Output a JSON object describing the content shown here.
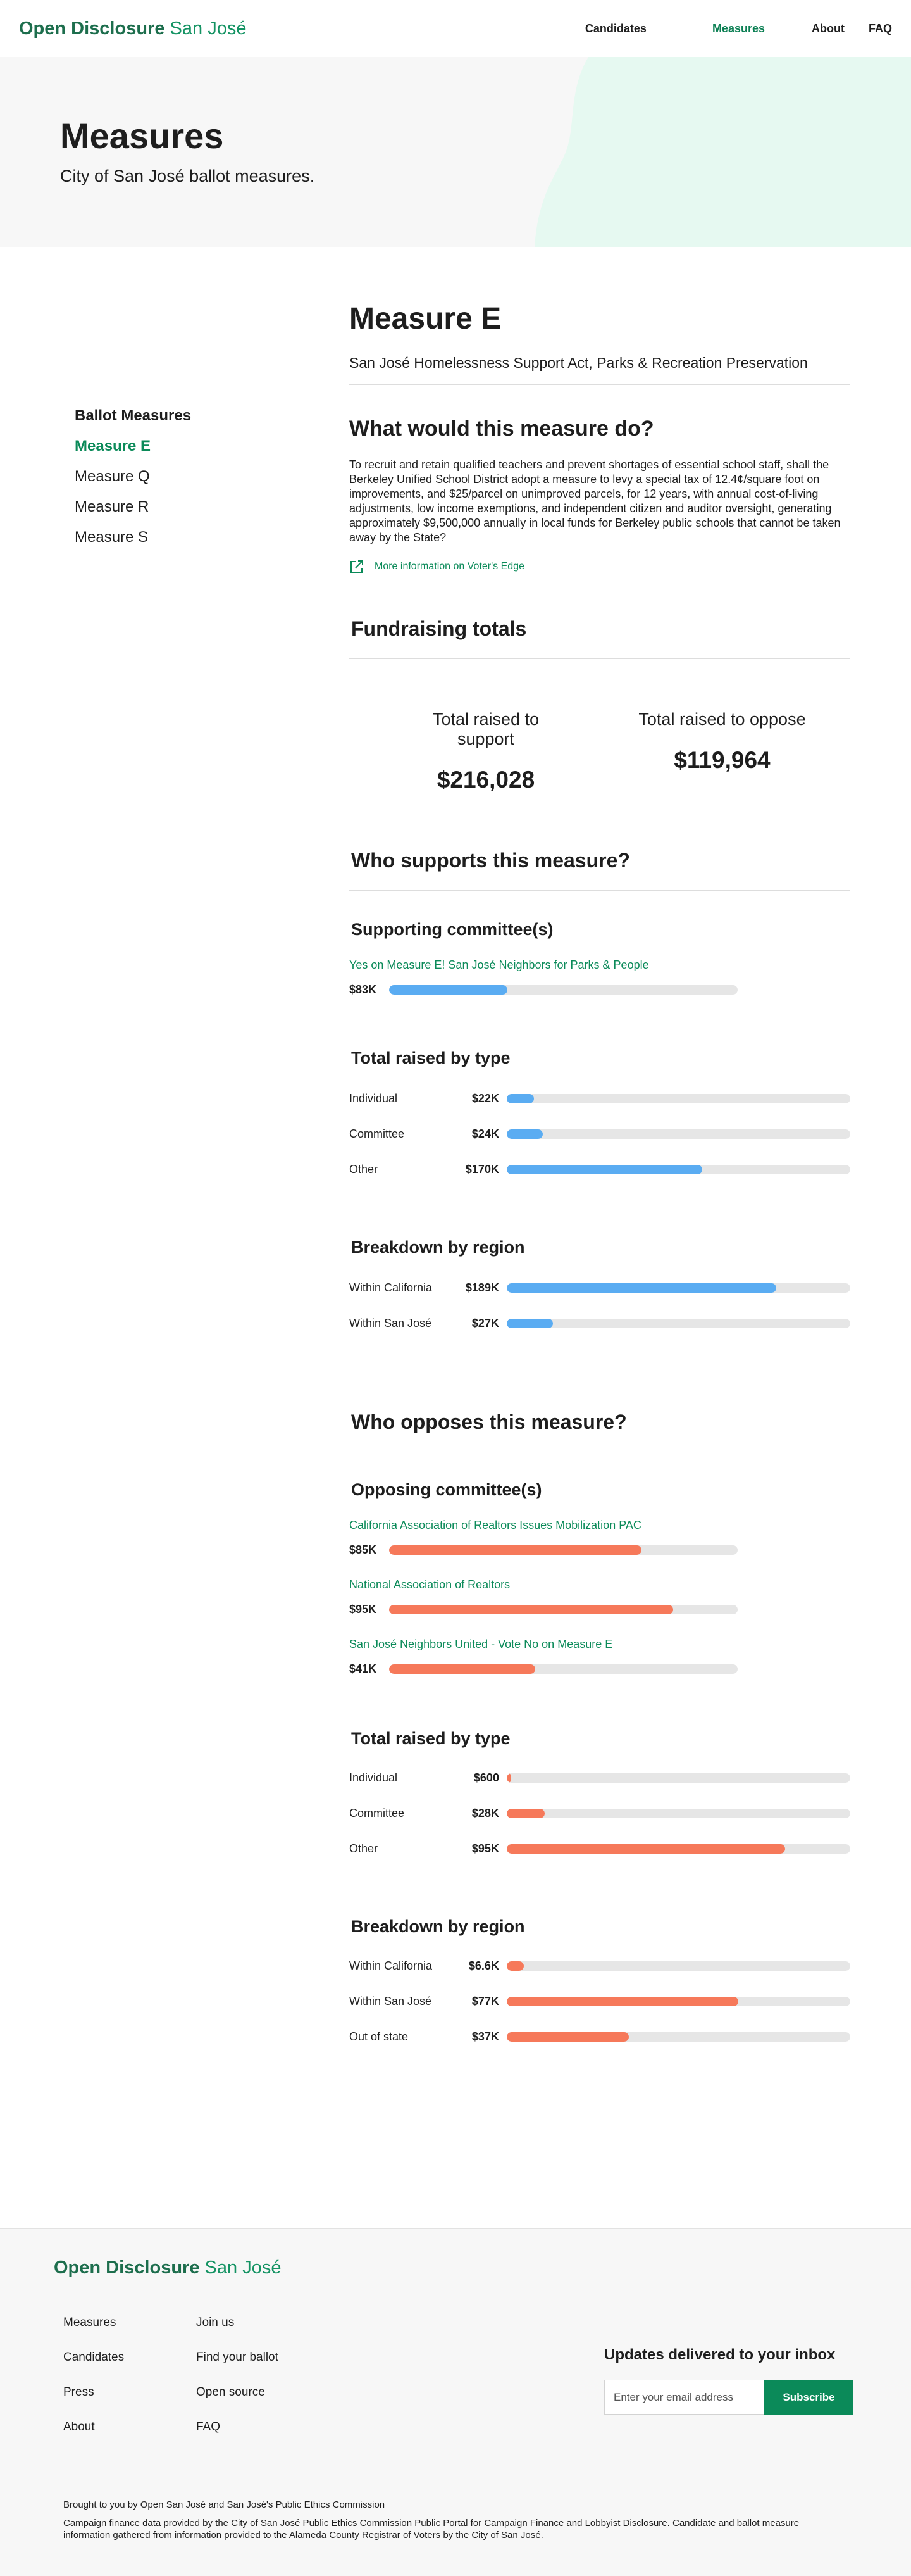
{
  "header": {
    "logo_main": "Open Disclosure",
    "logo_city": "San José",
    "nav": {
      "candidates": "Candidates",
      "measures": "Measures",
      "about": "About",
      "faq": "FAQ"
    }
  },
  "hero": {
    "title": "Measures",
    "subtitle": "City of San José  ballot measures."
  },
  "sidebar": {
    "heading": "Ballot Measures",
    "items": [
      "Measure E",
      "Measure Q",
      "Measure R",
      "Measure S"
    ]
  },
  "measure": {
    "title": "Measure E",
    "subtitle": "San José Homelessness Support  Act, Parks & Recreation Preservation",
    "question": "What would this measure do?",
    "description": "To recruit and retain qualified teachers and prevent shortages of essential school staff, shall the Berkeley Unified School District adopt a measure to levy a special tax of 12.4¢/square foot on improvements, and $25/parcel on unimproved parcels, for 12 years, with annual cost-of-living adjustments, low income exemptions, and independent citizen and auditor oversight, generating approximately $9,500,000 annually in local funds for Berkeley public schools that cannot be taken away by the State?",
    "link": "More information on Voter's Edge"
  },
  "fundraising": {
    "heading": "Fundraising totals",
    "support_label": "Total raised to support",
    "support_value": "$216,028",
    "oppose_label": "Total raised to oppose",
    "oppose_value": "$119,964"
  },
  "supporters": {
    "heading": "Who supports this measure?",
    "committees_heading": "Supporting committee(s)",
    "committees": [
      {
        "name": "Yes on Measure E! San José Neighbors for Parks & People",
        "amount": "$83K",
        "fraction": 0.34
      }
    ],
    "type_heading": "Total raised by type",
    "types": [
      {
        "label": "Individual",
        "amount": "$22K",
        "fraction": 0.08
      },
      {
        "label": "Committee",
        "amount": "$24K",
        "fraction": 0.105
      },
      {
        "label": "Other",
        "amount": "$170K",
        "fraction": 0.57
      }
    ],
    "region_heading": "Breakdown by region",
    "regions": [
      {
        "label": "Within California",
        "amount": "$189K",
        "fraction": 0.785
      },
      {
        "label": "Within San José",
        "amount": "$27K",
        "fraction": 0.135
      }
    ]
  },
  "opponents": {
    "heading": "Who opposes this measure?",
    "committees_heading": "Opposing committee(s)",
    "committees": [
      {
        "name": "California Association of Realtors Issues Mobilization PAC",
        "amount": "$85K",
        "fraction": 0.725
      },
      {
        "name": "National Association of Realtors",
        "amount": "$95K",
        "fraction": 0.815
      },
      {
        "name": "San José Neighbors United - Vote No on Measure E",
        "amount": "$41K",
        "fraction": 0.42
      }
    ],
    "type_heading": "Total raised by type",
    "types": [
      {
        "label": "Individual",
        "amount": "$600",
        "fraction": 0.012
      },
      {
        "label": "Committee",
        "amount": "$28K",
        "fraction": 0.11
      },
      {
        "label": "Other",
        "amount": "$95K",
        "fraction": 0.81
      }
    ],
    "region_heading": "Breakdown by region",
    "regions": [
      {
        "label": "Within California",
        "amount": "$6.6K",
        "fraction": 0.05
      },
      {
        "label": "Within San José",
        "amount": "$77K",
        "fraction": 0.675
      },
      {
        "label": "Out of state",
        "amount": "$37K",
        "fraction": 0.355
      }
    ]
  },
  "footer": {
    "logo_main": "Open Disclosure",
    "logo_city": "San José",
    "col1": [
      "Measures",
      "Candidates",
      "Press",
      "About"
    ],
    "col2": [
      "Join us",
      "Find your ballot",
      "Open source",
      "FAQ"
    ],
    "updates_heading": "Updates delivered to your inbox",
    "email_placeholder": "Enter your email address",
    "subscribe": "Subscribe",
    "brought": "Brought to you by Open San José and San José's Public Ethics Commission",
    "note": "Campaign finance data provided by the City of San José Public Ethics Commission Public Portal for Campaign Finance and Lobbyist Disclosure. Candidate and ballot measure information gathered from information provided to the Alameda County Registrar of Voters by the City of San José."
  },
  "colors": {
    "brand_green": "#0b8a59",
    "support_blue": "#5aacf2",
    "oppose_coral": "#f6795a",
    "hero_blob": "#e6f9f1"
  }
}
